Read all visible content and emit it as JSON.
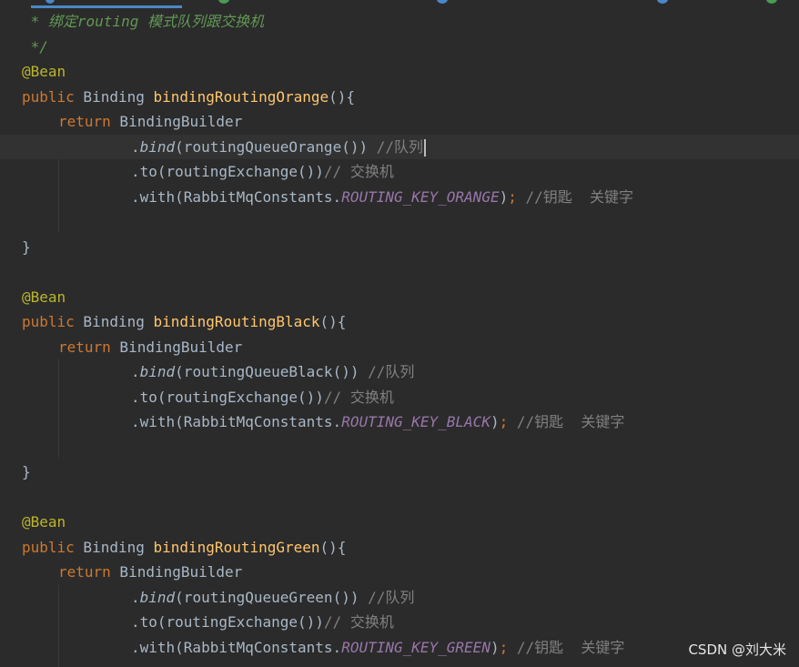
{
  "editor": {
    "language": "java",
    "theme": "darcula",
    "doc_comment": {
      "line1": " * 绑定routing 模式队列跟交换机",
      "line2": " */"
    },
    "annotation": "@Bean",
    "keyword_public": "public",
    "keyword_return": "return",
    "return_type": " Binding ",
    "builder": " BindingBuilder",
    "close_brace": "}",
    "method_suffix": "(){",
    "bind_method": "bind",
    "to_call": ".to(routingExchange())",
    "with_prefix": ".with(RabbitMqConstants.",
    "semicolon": ";",
    "comment_queue": "//队列",
    "comment_exchange": "// 交换机",
    "comment_key": "//钥匙  关键字",
    "bindings": [
      {
        "method": "bindingRoutingOrange",
        "queue_call": "(routingQueueOrange())",
        "key_constant": "ROUTING_KEY_ORANGE"
      },
      {
        "method": "bindingRoutingBlack",
        "queue_call": "(routingQueueBlack())",
        "key_constant": "ROUTING_KEY_BLACK"
      },
      {
        "method": "bindingRoutingGreen",
        "queue_call": "(routingQueueGreen())",
        "key_constant": "ROUTING_KEY_GREEN"
      }
    ]
  },
  "colors": {
    "background": "#2b2b2b",
    "current_line": "#323232",
    "keyword": "#cc7832",
    "annotation": "#bbb529",
    "method_name": "#ffc66d",
    "constant": "#9876aa",
    "comment": "#808080",
    "doc_comment": "#629755",
    "default_text": "#a9b7c6"
  },
  "watermark": "CSDN @刘大米"
}
